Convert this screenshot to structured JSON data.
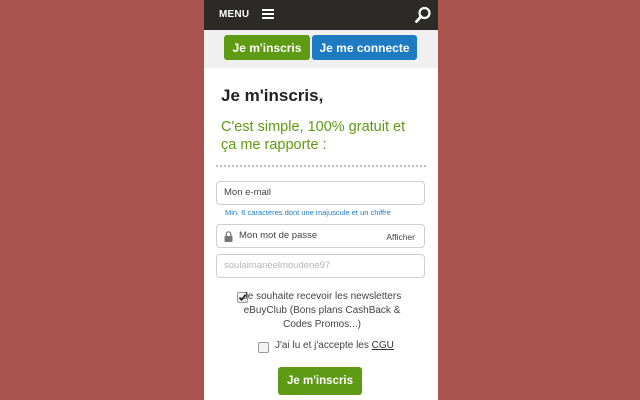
{
  "header": {
    "menu_label": "MENU",
    "menu_icon": "hamburger-icon",
    "search_icon": "search-icon"
  },
  "tabs": {
    "signup_label": "Je m'inscris",
    "login_label": "Je me connecte"
  },
  "form": {
    "title": "Je m'inscris,",
    "subtitle": "C'est simple, 100% gratuit et ça me rapporte :",
    "email_placeholder": "Mon e-mail",
    "password_hint": "Min. 6 caractères dont une majuscule et un chiffre",
    "password_placeholder": "Mon mot de passe",
    "password_icon": "lock-icon",
    "show_password_label": "Afficher",
    "username_value": "soulaimaneelmoudene97",
    "newsletter_label": "Je souhaite recevoir les newsletters eBuyClub (Bons plans CashBack & Codes Promos...)",
    "newsletter_checked": true,
    "cgu_prefix": "J'ai lu et j'accepte les ",
    "cgu_link": "CGU",
    "cgu_checked": false,
    "submit_label": "Je m'inscris"
  },
  "colors": {
    "background": "#a9534f",
    "header": "#2b2a26",
    "accent_green": "#5f9a14",
    "accent_blue": "#1e7bc2"
  }
}
